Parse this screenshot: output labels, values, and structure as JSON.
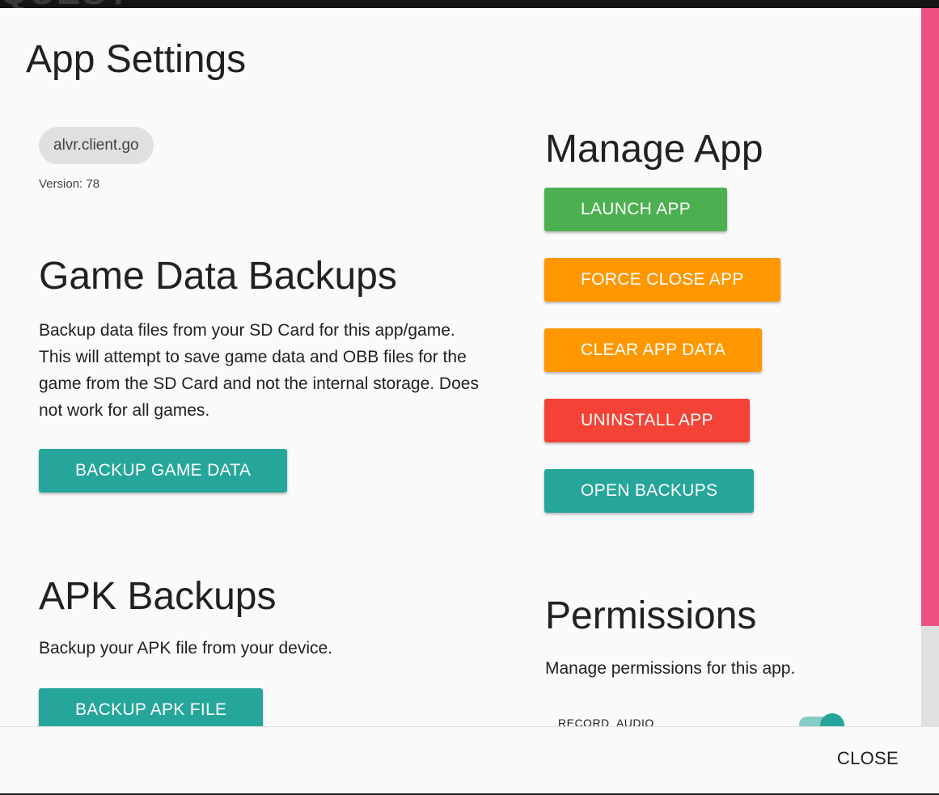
{
  "background": {
    "ghost_text": "QUEST"
  },
  "dialog": {
    "title": "App Settings",
    "package_chip": "alvr.client.go",
    "version_label": "Version: 78",
    "game_data": {
      "heading": "Game Data Backups",
      "description_lines": [
        "Backup data files from your SD Card for this app/game.",
        "This will attempt to save game data and OBB files for the",
        "game from the SD Card and not the internal storage. Does",
        "not work for all games."
      ],
      "button": "BACKUP GAME DATA"
    },
    "apk": {
      "heading": "APK Backups",
      "description": "Backup your APK file from your device.",
      "button": "BACKUP APK FILE"
    },
    "manage": {
      "heading": "Manage App",
      "buttons": {
        "launch": "LAUNCH APP",
        "force_close": "FORCE CLOSE APP",
        "clear_data": "CLEAR APP DATA",
        "uninstall": "UNINSTALL APP",
        "open_backups": "OPEN BACKUPS"
      }
    },
    "permissions": {
      "heading": "Permissions",
      "description": "Manage permissions for this app.",
      "items": [
        {
          "label": "RECORD_AUDIO",
          "enabled": true
        }
      ]
    },
    "footer": {
      "close": "CLOSE"
    }
  },
  "colors": {
    "teal": "#26a69a",
    "green": "#4caf50",
    "orange": "#ff9800",
    "red": "#f44336",
    "scroll_thumb": "#ec5080"
  }
}
